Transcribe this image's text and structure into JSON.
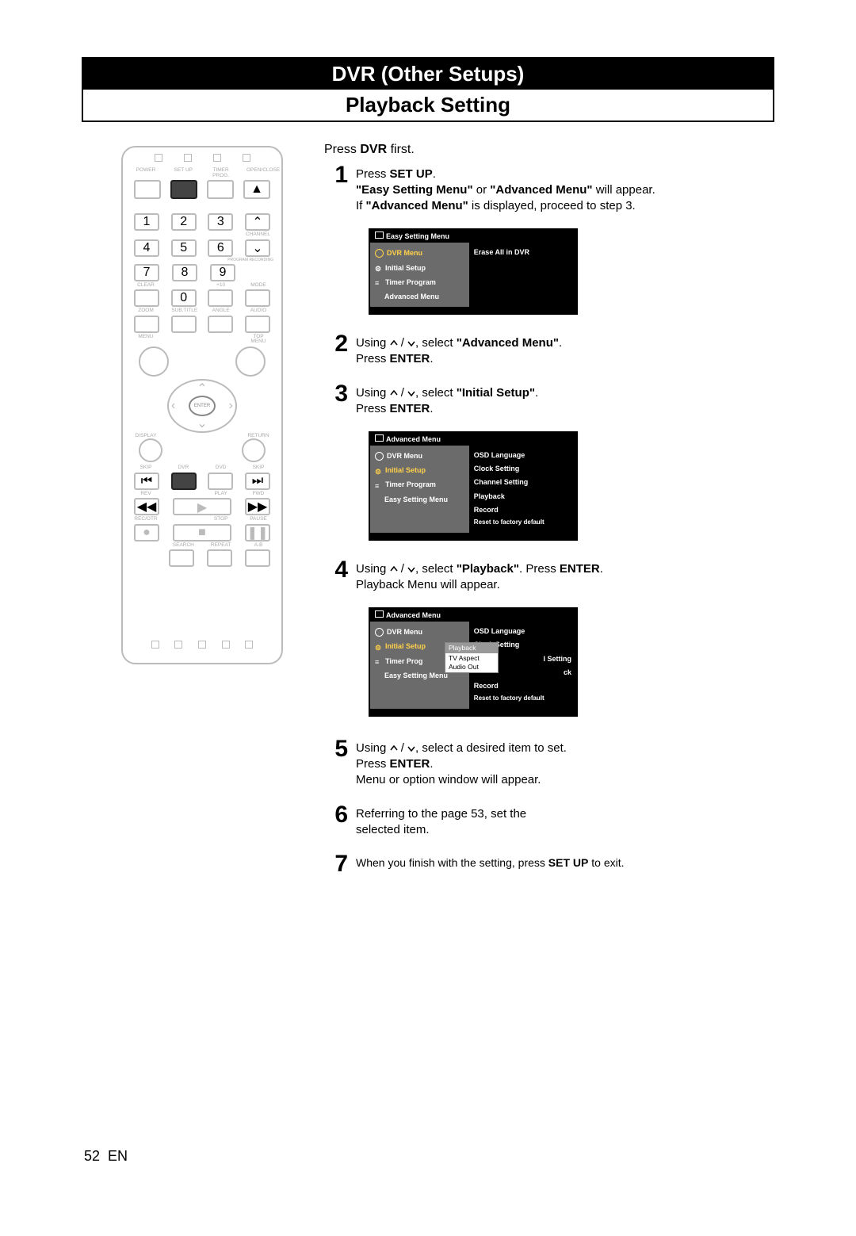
{
  "header_top": "DVR (Other Setups)",
  "header_bot": "Playback Setting",
  "intro": "Press ",
  "intro_bold": "DVR",
  "intro_tail": " first.",
  "s1_a": "Press ",
  "s1_b": "SET UP",
  "s1_c": ".",
  "s1_line2a": "\"Easy Setting Menu\"",
  "s1_line2b": " or ",
  "s1_line2c": "\"Advanced Menu\"",
  "s1_line2d": " will appear.",
  "s1_line3a": "If ",
  "s1_line3b": "\"Advanced Menu\"",
  "s1_line3c": " is displayed, proceed to step 3.",
  "osd1_title": "Easy Setting Menu",
  "osd1_left": [
    "DVR Menu",
    "Initial Setup",
    "Timer Program",
    "Advanced Menu"
  ],
  "osd1_right": [
    "Erase All in DVR"
  ],
  "s2_a": "Using ",
  "s2_b": ", select ",
  "s2_c": "\"Advanced Menu\"",
  "s2_d": ".",
  "s2_e": "Press ",
  "s2_f": "ENTER",
  "s3_a": "Using ",
  "s3_b": ", select ",
  "s3_c": "\"Initial Setup\"",
  "s3_d": ".",
  "s3_e": "Press ",
  "s3_f": "ENTER",
  "osd2_title": "Advanced Menu",
  "osd2_left": [
    "DVR Menu",
    "Initial Setup",
    "Timer Program",
    "Easy Setting Menu"
  ],
  "osd2_right": [
    "OSD Language",
    "Clock Setting",
    "Channel Setting",
    "Playback",
    "Record",
    "Reset to factory default"
  ],
  "s4_a": "Using ",
  "s4_b": ", select ",
  "s4_c": "\"Playback\"",
  "s4_d": ".  Press ",
  "s4_e": "ENTER",
  "s4_f": ".",
  "s4_g": "Playback Menu will appear.",
  "osd3_title": "Advanced Menu",
  "osd3_left": [
    "DVR Menu",
    "Initial Setup",
    "Timer Prog",
    "Easy Setting Menu"
  ],
  "osd3_right": [
    "OSD Language",
    "Clock Setting",
    "l Setting",
    "ck",
    "Record",
    "Reset to factory default"
  ],
  "osd3_pop": [
    "Playback",
    "TV Aspect",
    "Audio Out"
  ],
  "s5_a": "Using ",
  "s5_b": ", select a desired item to set.",
  "s5_c": "Press ",
  "s5_d": "ENTER",
  "s5_e": ".",
  "s5_f": "Menu or option window will appear.",
  "s6_a": "Referring to the page 53, set the",
  "s6_b": "selected item.",
  "s7_a": "When you finish with the setting,  press ",
  "s7_b": "SET UP",
  "s7_c": " to exit.",
  "footer_page": "52",
  "footer_lang": "EN",
  "remote_labels": {
    "r1": [
      "POWER",
      "SET UP",
      "TIMER PROG.",
      "OPEN/CLOSE"
    ],
    "r5": [
      "CLEAR",
      "",
      "+10",
      "MODE"
    ],
    "r6": [
      "ZOOM",
      "SUB.TITLE",
      "ANGLE",
      "AUDIO"
    ],
    "rmenu": [
      "MENU",
      "",
      "",
      "TOP MENU"
    ],
    "rdisp": [
      "DISPLAY",
      "",
      "",
      "RETURN"
    ],
    "rskip": [
      "SKIP",
      "DVR",
      "DVD",
      "SKIP"
    ],
    "rrev": [
      "REV",
      "",
      "PLAY",
      "FWD"
    ],
    "rrec": [
      "REC/OTR",
      "",
      "STOP",
      "PAUSE"
    ],
    "rsrch": [
      "",
      "SEARCH",
      "REPEAT",
      "A-B"
    ],
    "channel": "CHANNEL",
    "enter": "ENTER",
    "progrec": "PROGRAM RECORDING"
  }
}
